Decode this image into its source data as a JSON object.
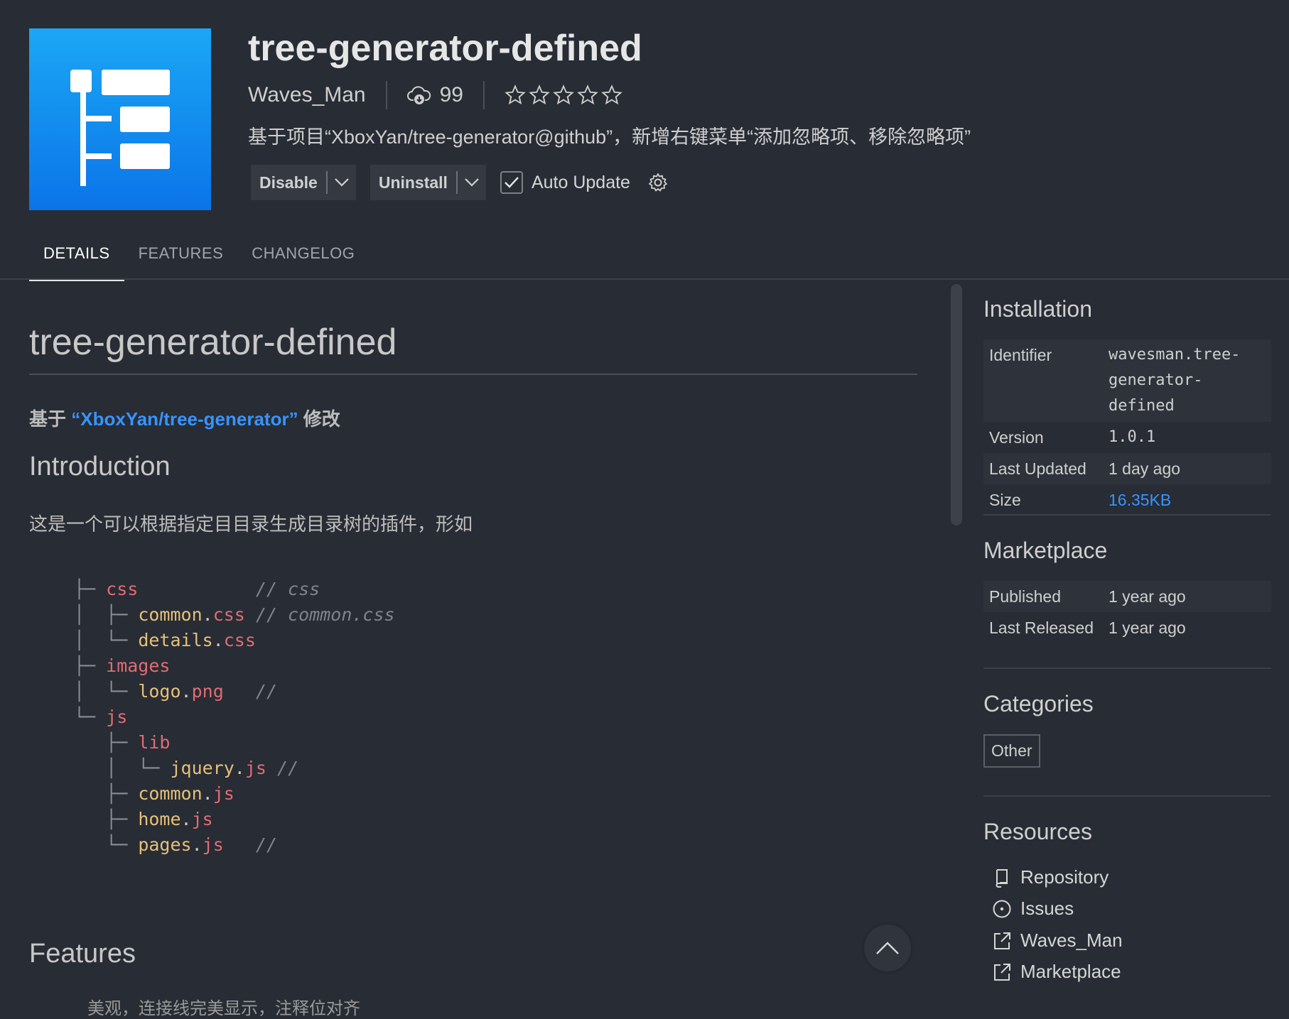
{
  "extension": {
    "name": "tree-generator-defined",
    "publisher": "Waves_Man",
    "downloads": "99",
    "rating_stars": 0,
    "description": "基于项目“XboxYan/tree-generator@github”，新增右键菜单“添加忽略项、移除忽略项”"
  },
  "actions": {
    "disable_label": "Disable",
    "uninstall_label": "Uninstall",
    "auto_update_label": "Auto Update",
    "auto_update_checked": true
  },
  "tabs": [
    {
      "label": "DETAILS",
      "active": true
    },
    {
      "label": "FEATURES",
      "active": false
    },
    {
      "label": "CHANGELOG",
      "active": false
    }
  ],
  "readme": {
    "title": "tree-generator-defined",
    "based_on_prefix": "基于",
    "based_on_link": "“XboxYan/tree-generator”",
    "based_on_suffix": "修改",
    "intro_heading": "Introduction",
    "intro_text": "这是一个可以根据指定目目录生成目录树的插件，形如",
    "features_heading": "Features",
    "features_first_line": "美观，连接线完美显示，注释位对齐",
    "tree": [
      {
        "prefix": "├─ ",
        "name": "css",
        "ext": "",
        "comment": "// css"
      },
      {
        "prefix": "│  ├─ ",
        "name": "common",
        "ext": ".css",
        "comment": "// common.css"
      },
      {
        "prefix": "│  └─ ",
        "name": "details",
        "ext": ".css",
        "comment": ""
      },
      {
        "prefix": "├─ ",
        "name": "images",
        "ext": "",
        "comment": ""
      },
      {
        "prefix": "│  └─ ",
        "name": "logo",
        "ext": ".png",
        "comment": "//"
      },
      {
        "prefix": "└─ ",
        "name": "js",
        "ext": "",
        "comment": ""
      },
      {
        "prefix": "   ├─ ",
        "name": "lib",
        "ext": "",
        "comment": ""
      },
      {
        "prefix": "   │  └─ ",
        "name": "jquery",
        "ext": ".js",
        "comment": "//"
      },
      {
        "prefix": "   ├─ ",
        "name": "common",
        "ext": ".js",
        "comment": ""
      },
      {
        "prefix": "   ├─ ",
        "name": "home",
        "ext": ".js",
        "comment": ""
      },
      {
        "prefix": "   └─ ",
        "name": "pages",
        "ext": ".js",
        "comment": "//"
      }
    ]
  },
  "sidebar": {
    "installation": {
      "heading": "Installation",
      "identifier_label": "Identifier",
      "identifier_value": "wavesman.tree-generator-defined",
      "version_label": "Version",
      "version_value": "1.0.1",
      "last_updated_label": "Last Updated",
      "last_updated_value": "1 day ago",
      "size_label": "Size",
      "size_value": "16.35KB"
    },
    "marketplace": {
      "heading": "Marketplace",
      "published_label": "Published",
      "published_value": "1 year ago",
      "last_released_label": "Last Released",
      "last_released_value": "1 year ago"
    },
    "categories": {
      "heading": "Categories",
      "items": [
        "Other"
      ]
    },
    "resources": {
      "heading": "Resources",
      "items": [
        {
          "label": "Repository",
          "icon": "repo-icon"
        },
        {
          "label": "Issues",
          "icon": "issues-icon"
        },
        {
          "label": "Waves_Man",
          "icon": "external-link-icon"
        },
        {
          "label": "Marketplace",
          "icon": "external-link-icon"
        }
      ]
    }
  },
  "colors": {
    "background": "#282c34",
    "link": "#3794ff",
    "logo_gradient_top": "#1ba7f5",
    "logo_gradient_bottom": "#0b74e8"
  }
}
